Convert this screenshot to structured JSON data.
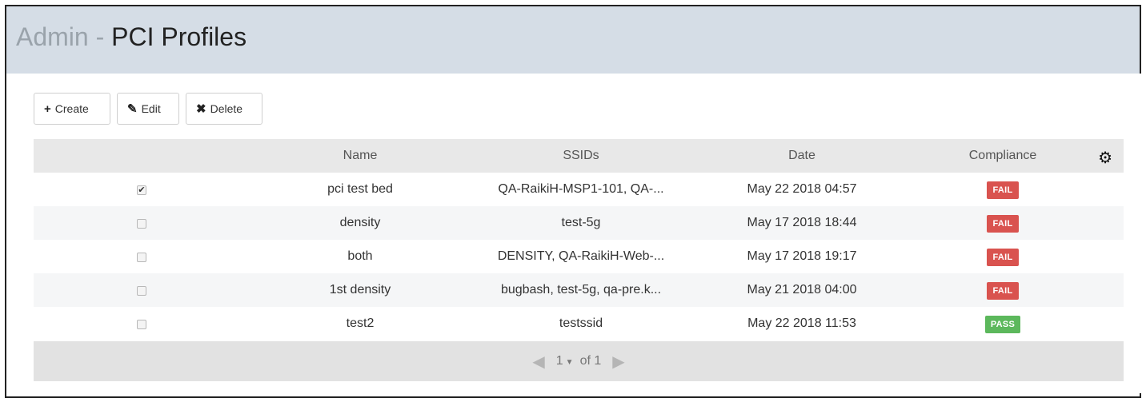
{
  "header": {
    "title_prefix": "Admin",
    "title_separator": "-",
    "title_name": "PCI Profiles"
  },
  "toolbar": {
    "create_icon": "+",
    "create_label": "Create",
    "edit_icon": "✎",
    "edit_label": "Edit",
    "delete_icon": "✖",
    "delete_label": "Delete"
  },
  "table": {
    "columns": [
      "Name",
      "SSIDs",
      "Date",
      "Compliance"
    ],
    "settings_icon": "gear-icon",
    "rows": [
      {
        "checked": "✔",
        "name": "pci test bed",
        "ssids": "QA-RaikiH-MSP1-101, QA-...",
        "date": "May 22 2018 04:57",
        "compliance": "FAIL"
      },
      {
        "checked": "",
        "name": "density",
        "ssids": "test-5g",
        "date": "May 17 2018 18:44",
        "compliance": "FAIL"
      },
      {
        "checked": "",
        "name": "both",
        "ssids": "DENSITY, QA-RaikiH-Web-...",
        "date": "May 17 2018 19:17",
        "compliance": "FAIL"
      },
      {
        "checked": "",
        "name": "1st density",
        "ssids": "bugbash, test-5g, qa-pre.k...",
        "date": "May 21 2018 04:00",
        "compliance": "FAIL"
      },
      {
        "checked": "",
        "name": "test2",
        "ssids": "testssid",
        "date": "May 22 2018 11:53",
        "compliance": "PASS"
      }
    ]
  },
  "pager": {
    "current_page": "1",
    "caret": "▼",
    "of_label": "of 1"
  },
  "colors": {
    "header_bg": "#d5dde6",
    "fail": "#d9534f",
    "pass": "#5cb85c"
  }
}
